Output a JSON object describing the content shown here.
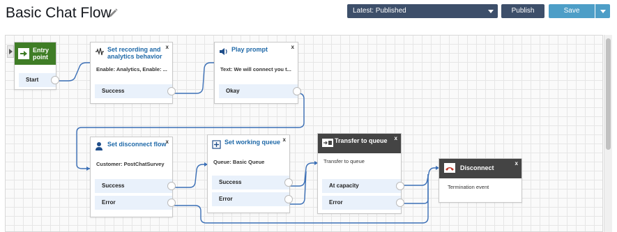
{
  "header": {
    "title": "Basic Chat Flow",
    "version_label": "Latest: Published",
    "publish_label": "Publish",
    "save_label": "Save"
  },
  "colors": {
    "nav_button": "#3d4f6a",
    "save_button": "#4d9ec7",
    "entry_block": "#3f7d26",
    "dark_header": "#444444",
    "link_blue": "#1f69a8",
    "connector": "#3b6fb6"
  },
  "blocks": {
    "entry": {
      "title": "Entry point",
      "branch": "Start"
    },
    "recording": {
      "title": "Set recording and analytics behavior",
      "desc": "Enable: Analytics, Enable: ...",
      "branch": "Success",
      "close": "x"
    },
    "play_prompt": {
      "title": "Play prompt",
      "desc": "Text: We will connect you t...",
      "branch": "Okay",
      "close": "x"
    },
    "disconnect_flow": {
      "title": "Set disconnect flow",
      "desc": "Customer: PostChatSurvey",
      "branches": [
        "Success",
        "Error"
      ],
      "close": "x"
    },
    "working_queue": {
      "title": "Set working queue",
      "desc": "Queue: Basic Queue",
      "branches": [
        "Success",
        "Error"
      ],
      "close": "x"
    },
    "transfer": {
      "title": "Transfer to queue",
      "desc": "Transfer to queue",
      "branches": [
        "At capacity",
        "Error"
      ],
      "close": "x"
    },
    "disconnect": {
      "title": "Disconnect",
      "desc": "Termination event",
      "close": "x"
    }
  }
}
